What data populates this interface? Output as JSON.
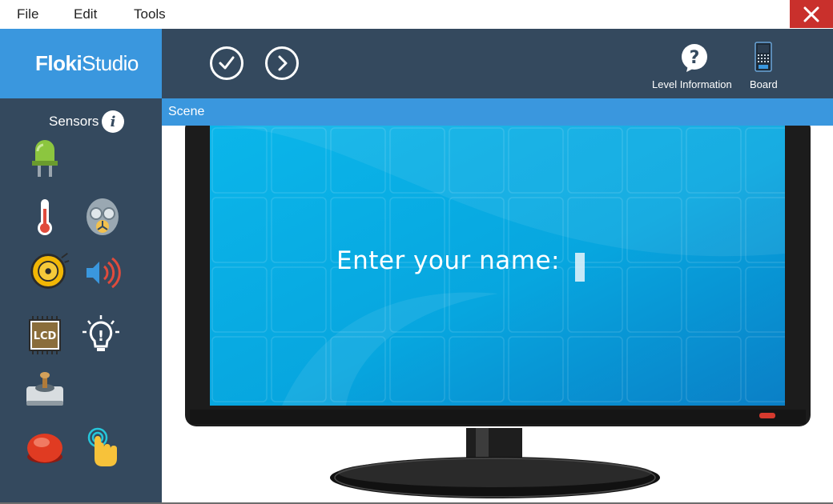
{
  "menu": {
    "file": "File",
    "edit": "Edit",
    "tools": "Tools"
  },
  "app": {
    "logo_bold": "Floki",
    "logo_light": "Studio"
  },
  "toolbar": {
    "check_icon": "check-circle-icon",
    "next_icon": "chevron-right-circle-icon",
    "level_info_label": "Level Information",
    "board_label": "Board"
  },
  "sidebar": {
    "title": "Sensors",
    "sensors": [
      {
        "name": "led-icon"
      },
      {
        "name": "thermometer-icon"
      },
      {
        "name": "gas-sensor-icon"
      },
      {
        "name": "buzzer-bell-icon"
      },
      {
        "name": "speaker-icon"
      },
      {
        "name": "lcd-icon"
      },
      {
        "name": "light-bulb-icon"
      },
      {
        "name": "joystick-icon"
      },
      {
        "name": "push-button-icon"
      },
      {
        "name": "touch-sensor-icon"
      }
    ]
  },
  "scene": {
    "label": "Scene",
    "prompt": "Enter your name: "
  },
  "colors": {
    "brand_blue": "#3a97de",
    "panel_dark": "#34495e",
    "close_red": "#c9302c",
    "screen_blue": "#0aa8e0"
  }
}
